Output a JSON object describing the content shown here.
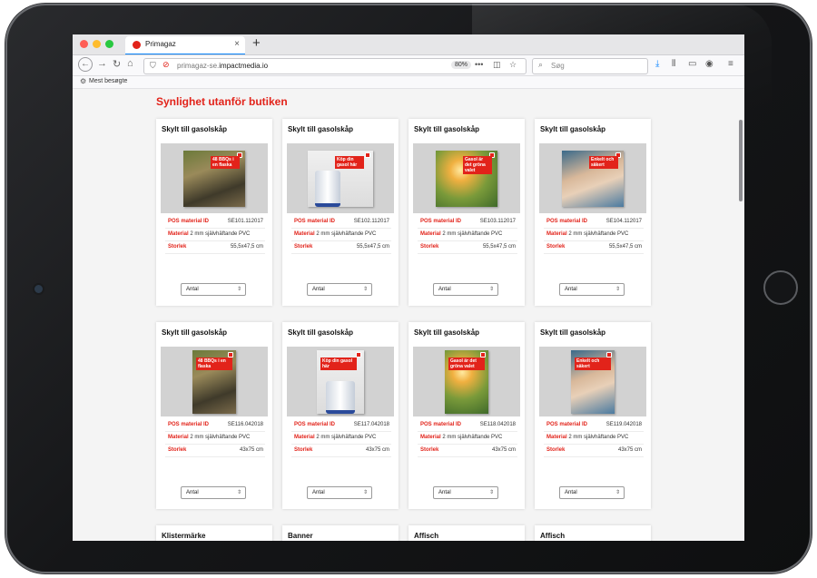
{
  "browser": {
    "tab_title": "Primagaz",
    "tab_close": "×",
    "new_tab": "+",
    "url_prefix": "primagaz-se.",
    "url_domain": "impactmedia.io",
    "zoom": "80%",
    "search_placeholder": "Søg",
    "bookmark_label": "Mest besøgte"
  },
  "page": {
    "title": "Synlighet utanför butiken"
  },
  "labels": {
    "pos_id": "POS material ID",
    "material": "Material",
    "size": "Storlek",
    "select": "Antal"
  },
  "row1": [
    {
      "title": "Skylt till gasolskåp",
      "id": "SE101.112017",
      "material": "2 mm självhäftande PVC",
      "size": "55,5x47,5 cm",
      "poster_text": "48 BBQs i en flaska",
      "theme": "red"
    },
    {
      "title": "Skylt till gasolskåp",
      "id": "SE102.112017",
      "material": "2 mm självhäftande PVC",
      "size": "55,5x47,5 cm",
      "poster_text": "Köp din gasol här",
      "theme": "product"
    },
    {
      "title": "Skylt till gasolskåp",
      "id": "SE103.112017",
      "material": "2 mm självhäftande PVC",
      "size": "55,5x47,5 cm",
      "poster_text": "Gasol är det gröna valet",
      "theme": "green"
    },
    {
      "title": "Skylt till gasolskåp",
      "id": "SE104.112017",
      "material": "2 mm självhäftande PVC",
      "size": "55,5x47,5 cm",
      "poster_text": "Enkelt och säkert",
      "theme": "kids"
    }
  ],
  "row2": [
    {
      "title": "Skylt till gasolskåp",
      "id": "SE116.042018",
      "material": "2 mm självhäftande PVC",
      "size": "43x75 cm",
      "poster_text": "48 BBQs i en flaska",
      "theme": "red"
    },
    {
      "title": "Skylt till gasolskåp",
      "id": "SE117.042018",
      "material": "2 mm självhäftande PVC",
      "size": "43x75 cm",
      "poster_text": "Köp din gasol här",
      "theme": "product"
    },
    {
      "title": "Skylt till gasolskåp",
      "id": "SE118.042018",
      "material": "2 mm självhäftande PVC",
      "size": "43x75 cm",
      "poster_text": "Gasol är det gröna valet",
      "theme": "green"
    },
    {
      "title": "Skylt till gasolskåp",
      "id": "SE119.042018",
      "material": "2 mm självhäftande PVC",
      "size": "43x75 cm",
      "poster_text": "Enkelt och säkert",
      "theme": "kids"
    }
  ],
  "row3": [
    {
      "title": "Klistermärke"
    },
    {
      "title": "Banner"
    },
    {
      "title": "Affisch"
    },
    {
      "title": "Affisch"
    }
  ],
  "colors": {
    "brand_red": "#e2231a",
    "accent_blue": "#0a84ff"
  }
}
